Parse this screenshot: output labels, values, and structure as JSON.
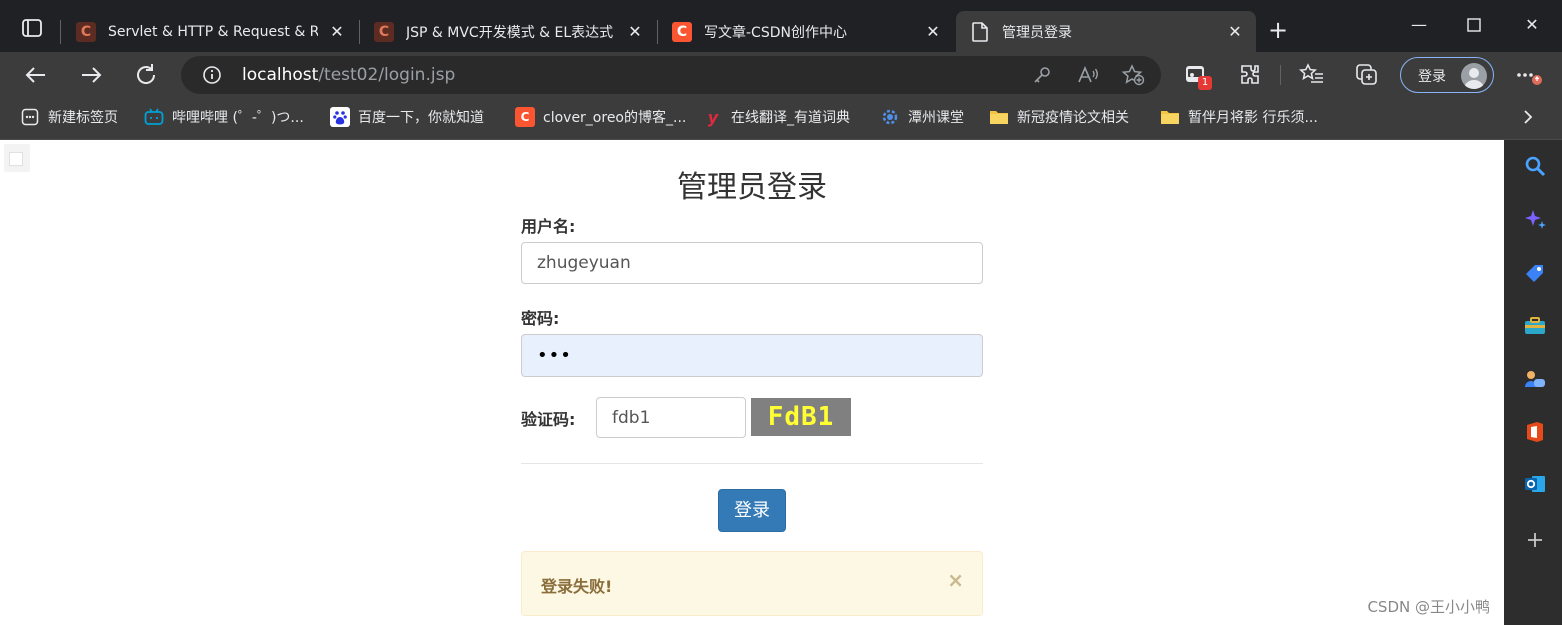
{
  "tabs": [
    {
      "title": "Servlet & HTTP & Request & Res",
      "favicon": "C"
    },
    {
      "title": "JSP & MVC开发模式 & EL表达式",
      "favicon": "C"
    },
    {
      "title": "写文章-CSDN创作中心",
      "favicon": "C"
    },
    {
      "title": "管理员登录",
      "favicon": "page",
      "active": true
    }
  ],
  "toolbar": {
    "url_host": "localhost",
    "url_path": "/test02/login.jsp",
    "login_label": "登录",
    "extension_badge": "1"
  },
  "bookmarks": [
    {
      "label": "新建标签页"
    },
    {
      "label": "哔哩哔哩 (゜-゜)つ..."
    },
    {
      "label": "百度一下，你就知道"
    },
    {
      "label": "clover_oreo的博客_..."
    },
    {
      "label": "在线翻译_有道词典"
    },
    {
      "label": "潭州课堂"
    },
    {
      "label": "新冠疫情论文相关"
    },
    {
      "label": "暂伴月将影 行乐须..."
    }
  ],
  "page": {
    "title": "管理员登录",
    "username_label": "用户名:",
    "username_value": "zhugeyuan",
    "password_label": "密码:",
    "password_value": "•••",
    "captcha_label": "验证码:",
    "captcha_value": "fdb1",
    "captcha_image_text": "FdB1",
    "submit_label": "登录",
    "alert_message": "登录失败!",
    "alert_close": "×",
    "watermark": "CSDN @王小小鸭"
  },
  "colors": {
    "primary_button": "#337ab7",
    "alert_bg": "#fcf8e3",
    "alert_text": "#8a6d3b",
    "captcha_bg": "#808080",
    "captcha_text": "#ffff33"
  }
}
